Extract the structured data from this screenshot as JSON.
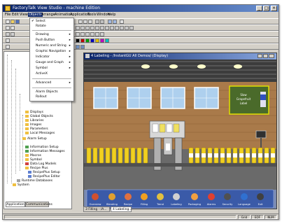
{
  "window": {
    "title": "FactoryTalk View Studio - machine Edition"
  },
  "menu": [
    "File",
    "Edit",
    "View",
    "Objects",
    "Arrange",
    "Animation",
    "Application",
    "Tools",
    "Window",
    "Help"
  ],
  "objects_menu": {
    "items": [
      {
        "label": "Select",
        "submenu": false
      },
      {
        "label": "Rotate",
        "submenu": false
      },
      {
        "label": "Drawing",
        "submenu": true
      },
      {
        "label": "Push Button",
        "submenu": true
      },
      {
        "label": "Numeric and String",
        "submenu": true
      },
      {
        "label": "Graphic Navigation",
        "submenu": true
      },
      {
        "label": "Indicator",
        "submenu": true
      },
      {
        "label": "Gauge and Graph",
        "submenu": true
      },
      {
        "label": "Symbol",
        "submenu": true
      },
      {
        "label": "ActiveX",
        "submenu": false
      },
      {
        "label": "Advanced",
        "submenu": true
      },
      {
        "label": "Alarm Objects",
        "submenu": false
      },
      {
        "label": "Rollout",
        "submenu": false
      }
    ]
  },
  "tree": {
    "items": [
      "Displays",
      "Global Objects",
      "Libraries",
      "Images",
      "Parameters",
      "Local Messages",
      "Alarm Setup",
      "Information Setup",
      "Information Messages",
      "Macros",
      "Symbol",
      "Data Log Models",
      "Recipe Plus",
      "RecipePlus Setup",
      "RecipePlus Editor",
      "Runtime Databases",
      "System"
    ],
    "tabs": [
      "Application",
      "Communications"
    ]
  },
  "display": {
    "title": "4 Labeling - /InstantGU All Demos/ (Display)",
    "sign": [
      "Slaw",
      "Grapefruit",
      "Label"
    ],
    "nav_buttons": [
      "Overview",
      "Blending",
      "Recipe",
      "Filling",
      "Trend",
      "Labeling",
      "Packaging",
      "Alarms",
      "Security",
      "Language",
      "Exit"
    ]
  },
  "open_tabs": [
    "3 Filling - /A...",
    "4 Labeling..."
  ],
  "status": [
    "Grid",
    "EOF",
    "NUM"
  ]
}
